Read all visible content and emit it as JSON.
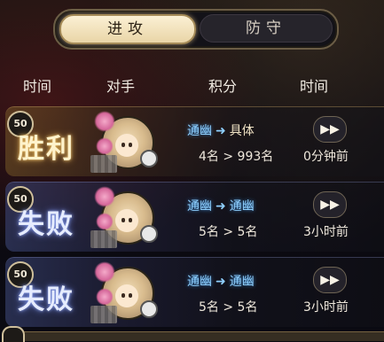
{
  "tabs": [
    {
      "label": "进攻",
      "active": true
    },
    {
      "label": "防守",
      "active": false
    }
  ],
  "headers": [
    "时间",
    "对手",
    "积分",
    "时间"
  ],
  "rows": [
    {
      "level": "50",
      "result": "胜利",
      "type": "win",
      "from": "通幽",
      "to": "具体",
      "score": "4名 > 993名",
      "time": "0分钟前"
    },
    {
      "level": "50",
      "result": "失败",
      "type": "lose",
      "from": "通幽",
      "to": "通幽",
      "score": "5名 > 5名",
      "time": "3小时前"
    },
    {
      "level": "50",
      "result": "失败",
      "type": "lose",
      "from": "通幽",
      "to": "通幽",
      "score": "5名 > 5名",
      "time": "3小时前"
    }
  ],
  "icons": {
    "arrow": "right-arrow-icon",
    "replay": "play-forward-icon"
  },
  "colors": {
    "win_glow": "#d8a548",
    "lose_glow": "#6f86e0",
    "rank_blue": "#8fd0ff",
    "tab_active": "#f3e3bd"
  }
}
